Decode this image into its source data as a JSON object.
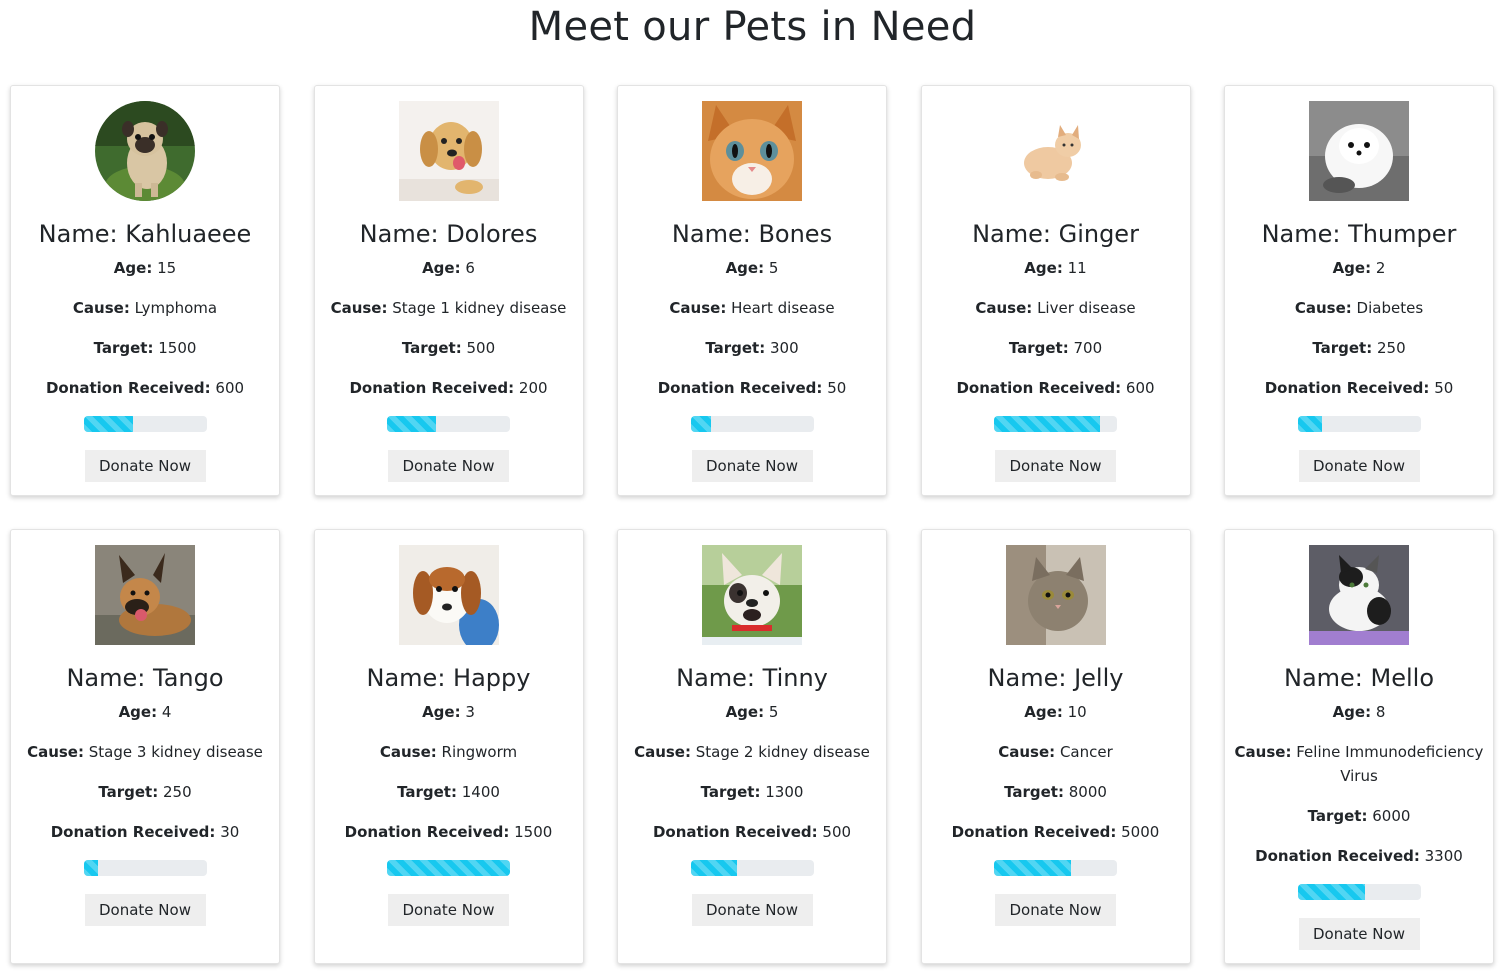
{
  "page": {
    "title": "Meet our Pets in Need"
  },
  "labels": {
    "name_prefix": "Name: ",
    "age": "Age:",
    "cause": "Cause:",
    "target": "Target:",
    "donation": "Donation Received:"
  },
  "pets": [
    {
      "name": "Kahluaeee",
      "age": "15",
      "cause": "Lymphoma",
      "target": "1500",
      "donation": "600",
      "progress": 0.4,
      "button": "Donate Now",
      "icon": "pug-photo"
    },
    {
      "name": "Dolores",
      "age": "6",
      "cause": "Stage 1 kidney disease",
      "target": "500",
      "donation": "200",
      "progress": 0.4,
      "button": "Donate Now",
      "icon": "golden-retriever-puppy-photo"
    },
    {
      "name": "Bones",
      "age": "5",
      "cause": "Heart disease",
      "target": "300",
      "donation": "50",
      "progress": 0.17,
      "button": "Donate Now",
      "icon": "orange-kitten-photo"
    },
    {
      "name": "Ginger",
      "age": "11",
      "cause": "Liver disease",
      "target": "700",
      "donation": "600",
      "progress": 0.86,
      "button": "Donate Now",
      "icon": "cream-cat-photo"
    },
    {
      "name": "Thumper",
      "age": "2",
      "cause": "Diabetes",
      "target": "250",
      "donation": "50",
      "progress": 0.2,
      "button": "Donate Now",
      "icon": "white-pomeranian-photo"
    },
    {
      "name": "Tango",
      "age": "4",
      "cause": "Stage 3 kidney disease",
      "target": "250",
      "donation": "30",
      "progress": 0.12,
      "button": "Donate Now",
      "icon": "german-shepherd-photo"
    },
    {
      "name": "Happy",
      "age": "3",
      "cause": "Ringworm",
      "target": "1400",
      "donation": "1500",
      "progress": 1.0,
      "button": "Donate Now",
      "icon": "beagle-puppy-photo"
    },
    {
      "name": "Tinny",
      "age": "5",
      "cause": "Stage 2 kidney disease",
      "target": "1300",
      "donation": "500",
      "progress": 0.38,
      "button": "Donate Now",
      "icon": "french-bulldog-photo"
    },
    {
      "name": "Jelly",
      "age": "10",
      "cause": "Cancer",
      "target": "8000",
      "donation": "5000",
      "progress": 0.625,
      "button": "Donate Now",
      "icon": "tabby-cat-photo"
    },
    {
      "name": "Mello",
      "age": "8",
      "cause": "Feline Immunodeficiency Virus",
      "target": "6000",
      "donation": "3300",
      "progress": 0.55,
      "button": "Donate Now",
      "icon": "black-white-cat-photo"
    }
  ],
  "colors": {
    "progress_fill": "#17c8ef",
    "progress_track": "#e9ecef",
    "button_bg": "#eeeeee"
  }
}
